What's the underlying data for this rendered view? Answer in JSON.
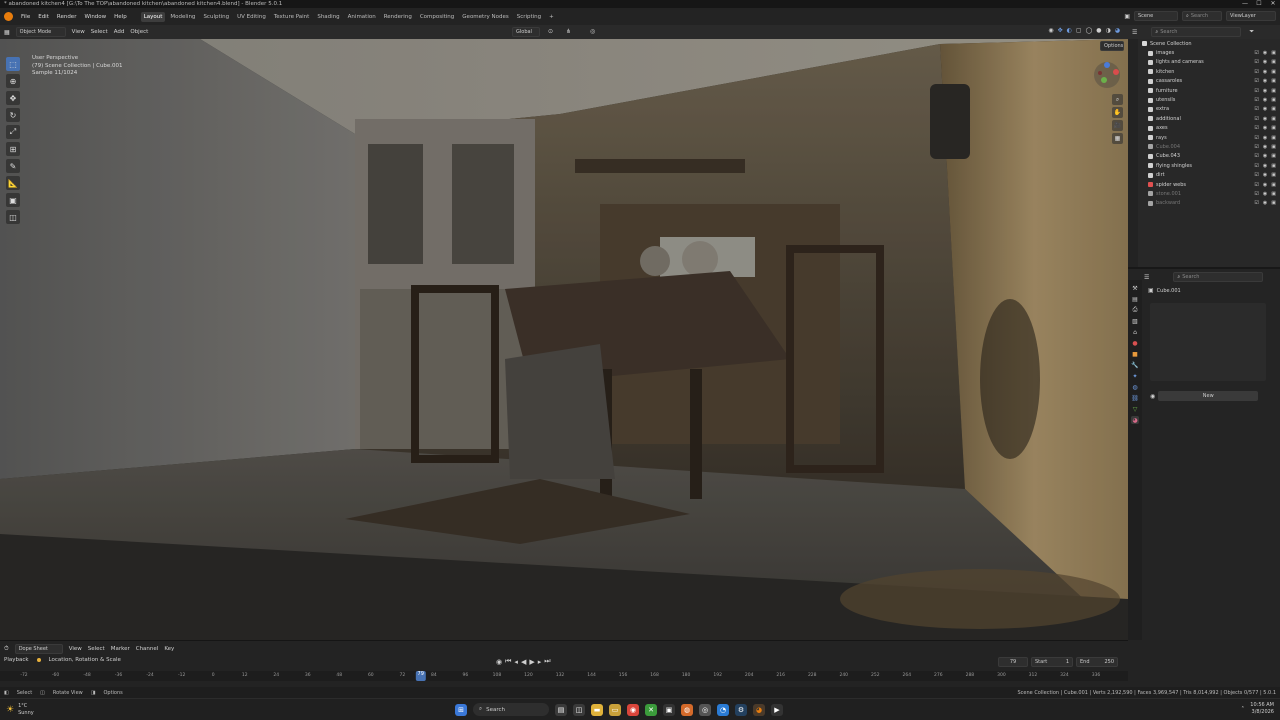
{
  "window": {
    "title": "* abandoned kitchen4 [G:\\To The TOP\\abandoned kitchen\\abandoned kitchen4.blend] - Blender 5.0.1",
    "controls": [
      "—",
      "☐",
      "✕"
    ]
  },
  "menubar": {
    "menus": [
      "File",
      "Edit",
      "Render",
      "Window",
      "Help"
    ],
    "workspaces": [
      "Layout",
      "Modeling",
      "Sculpting",
      "UV Editing",
      "Texture Paint",
      "Shading",
      "Animation",
      "Rendering",
      "Compositing",
      "Geometry Nodes",
      "Scripting"
    ],
    "active_workspace": "Layout",
    "add_tab": "+",
    "scene": "Scene",
    "search_placeholder": "Search",
    "view_layer": "ViewLayer"
  },
  "viewport_header": {
    "mode": "Object Mode",
    "menus": [
      "View",
      "Select",
      "Add",
      "Object"
    ],
    "orientation": "Global",
    "options": "Options"
  },
  "viewport_overlay": {
    "view": "User Perspective",
    "collection": "(79) Scene Collection | Cube.001",
    "sample": "Sample 11/1024"
  },
  "outliner": {
    "title": "Scene Collection",
    "search_placeholder": "Search",
    "items": [
      {
        "name": "images",
        "color": "#d0d0d0",
        "dim": false
      },
      {
        "name": "lights and cameras",
        "color": "#d0d0d0",
        "dim": false
      },
      {
        "name": "kitchen",
        "color": "#d0d0d0",
        "dim": false
      },
      {
        "name": "cassaroles",
        "color": "#d0d0d0",
        "dim": false
      },
      {
        "name": "furniture",
        "color": "#d0d0d0",
        "dim": false
      },
      {
        "name": "utensils",
        "color": "#d0d0d0",
        "dim": false
      },
      {
        "name": "extra",
        "color": "#d0d0d0",
        "dim": false
      },
      {
        "name": "additional",
        "color": "#d0d0d0",
        "dim": false
      },
      {
        "name": "axes",
        "color": "#d0d0d0",
        "dim": false
      },
      {
        "name": "rays",
        "color": "#d0d0d0",
        "dim": false
      },
      {
        "name": "Cube.004",
        "color": "#a3a3a3",
        "dim": true
      },
      {
        "name": "Cube.043",
        "color": "#d0d0d0",
        "dim": false
      },
      {
        "name": "flying shingles",
        "color": "#d0d0d0",
        "dim": false
      },
      {
        "name": "dirt",
        "color": "#d0d0d0",
        "dim": false
      },
      {
        "name": "spider webs",
        "color": "#e05050",
        "dim": false
      },
      {
        "name": "stone.001",
        "color": "#a3a3a3",
        "dim": true
      },
      {
        "name": "backward",
        "color": "#a3a3a3",
        "dim": true
      }
    ]
  },
  "properties": {
    "search_placeholder": "Search",
    "object": "Cube.001",
    "new_button": "New"
  },
  "timeline": {
    "editor": "Dope Sheet",
    "menus": [
      "View",
      "Select",
      "Marker",
      "Channel",
      "Key"
    ],
    "playback": "Playback",
    "keying": "Location, Rotation & Scale",
    "current_frame": "79",
    "start_label": "Start",
    "start": "1",
    "end_label": "End",
    "end": "250",
    "ticks": [
      "-72",
      "-60",
      "-48",
      "-36",
      "-24",
      "-12",
      "0",
      "12",
      "24",
      "36",
      "48",
      "60",
      "72",
      "84",
      "96",
      "108",
      "120",
      "132",
      "144",
      "156",
      "168",
      "180",
      "192",
      "204",
      "216",
      "228",
      "240",
      "252",
      "264",
      "276",
      "288",
      "300",
      "312",
      "324",
      "336"
    ],
    "playhead": "79"
  },
  "statusbar": {
    "left": [
      "Select",
      "Rotate View",
      "Options"
    ],
    "right": "Scene Collection | Cube.001 | Verts 2,192,590 | Faces 3,969,547 | Tris 8,014,992 | Objects 0/577 | 5.0.1"
  },
  "taskbar": {
    "weather_temp": "1°C",
    "weather_desc": "Sunny",
    "search": "Search",
    "time": "10:56 AM",
    "date": "3/8/2026"
  }
}
